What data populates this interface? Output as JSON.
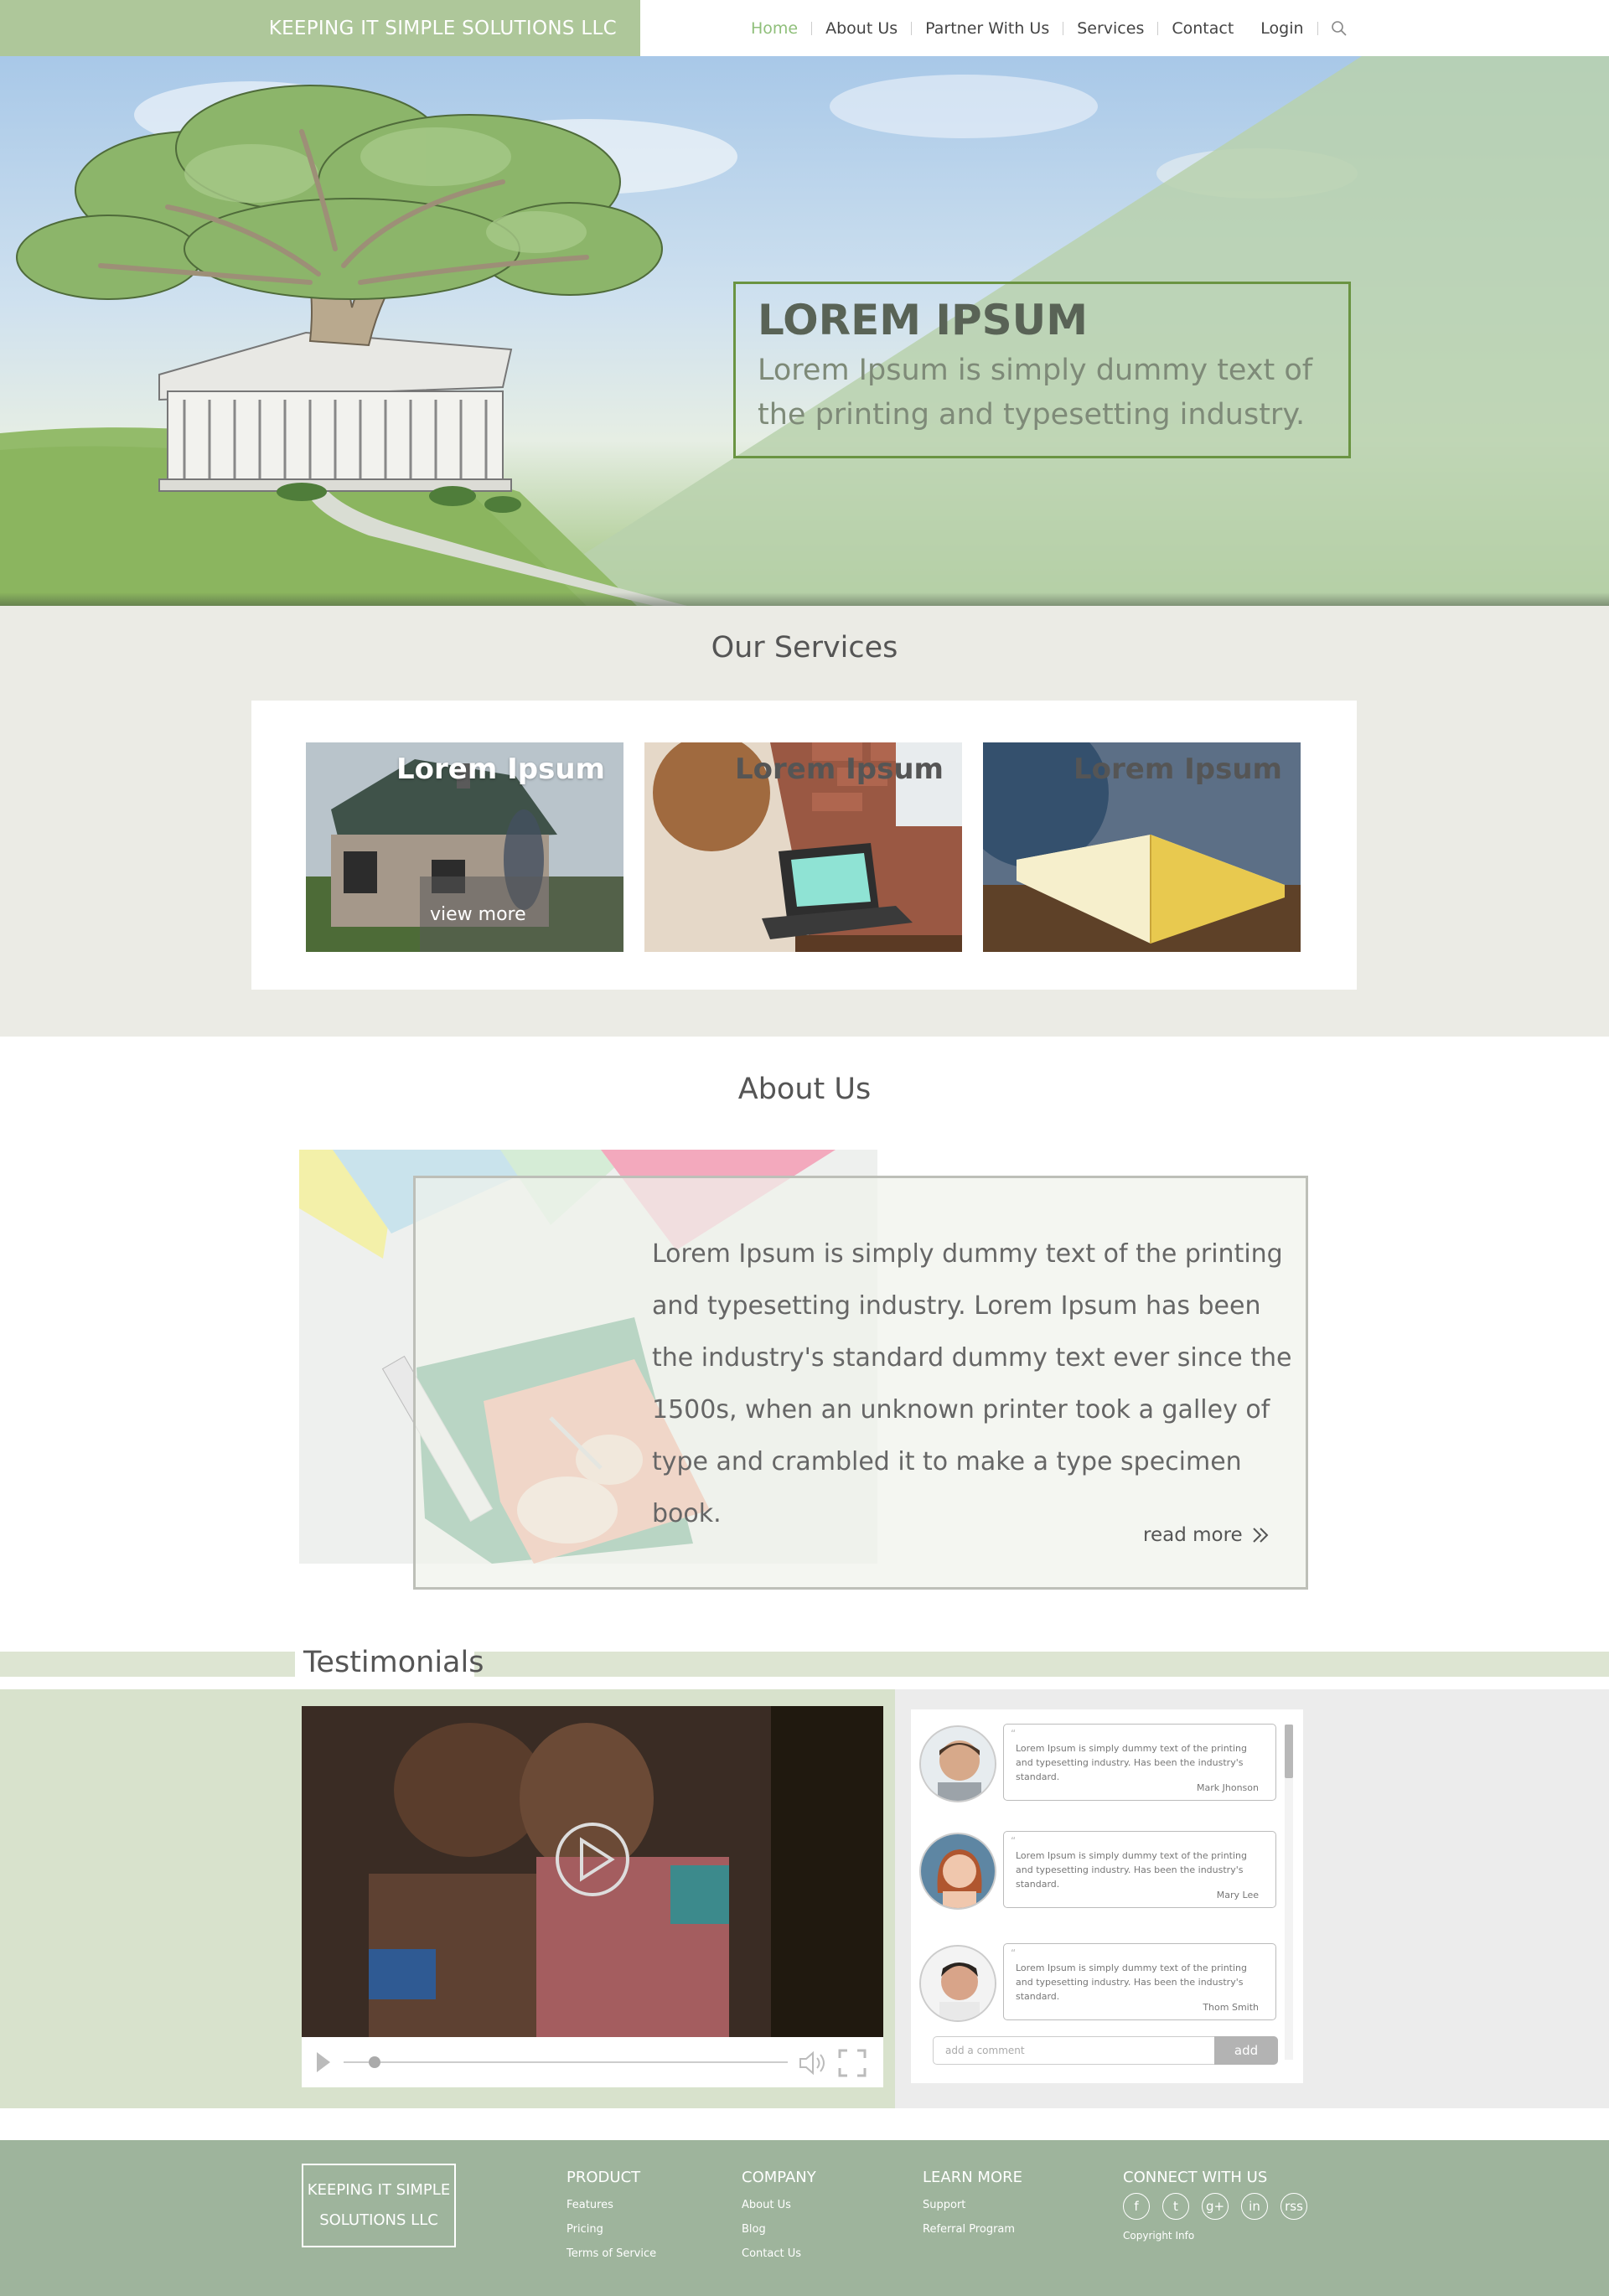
{
  "header": {
    "brand": "KEEPING IT SIMPLE SOLUTIONS LLC",
    "nav": [
      "Home",
      "About Us",
      "Partner With Us",
      "Services",
      "Contact",
      "Login"
    ],
    "search_icon": "search-icon"
  },
  "hero": {
    "title": "LOREM IPSUM",
    "subtitle": "Lorem Ipsum is simply dummy text of the printing and typesetting industry."
  },
  "services": {
    "title": "Our Services",
    "cards": [
      {
        "label": "Lorem Ipsum",
        "more": "view more"
      },
      {
        "label": "Lorem Ipsum"
      },
      {
        "label": "Lorem Ipsum"
      }
    ]
  },
  "about": {
    "title": "About Us",
    "text": "Lorem Ipsum is simply dummy text of the printing and typesetting industry. Lorem Ipsum has been the industry's standard dummy text ever since the 1500s, when an unknown printer took a galley of type and crambled it to make a type specimen book.",
    "read_more": "read more"
  },
  "testimonials": {
    "title": "Testimonials",
    "video": {
      "play_icon": "play-icon",
      "progress": 0.07
    },
    "comments": [
      {
        "quote": "“",
        "text": "Lorem Ipsum is simply dummy text of the printing and typesetting industry. Has been the industry's standard.",
        "name": "Mark Jhonson"
      },
      {
        "quote": "“",
        "text": "Lorem Ipsum is simply dummy text of the printing and typesetting industry. Has been the industry's standard.",
        "name": "Mary Lee"
      },
      {
        "quote": "“",
        "text": "Lorem Ipsum is simply dummy text of the printing and typesetting industry. Has been the industry's standard.",
        "name": "Thom Smith"
      }
    ],
    "comment_placeholder": "add a comment",
    "add_label": "add"
  },
  "footer": {
    "brand_line1": "KEEPING IT SIMPLE",
    "brand_line2": "SOLUTIONS LLC",
    "product": {
      "title": "PRODUCT",
      "links": [
        "Features",
        "Pricing",
        "Terms of Service"
      ]
    },
    "company": {
      "title": "COMPANY",
      "links": [
        "About Us",
        "Blog",
        "Contact Us"
      ]
    },
    "learn": {
      "title": "LEARN MORE",
      "links": [
        "Support",
        "Referral Program"
      ]
    },
    "connect": {
      "title": "CONNECT WITH US",
      "icons": [
        "f",
        "t",
        "g+",
        "in",
        "rss"
      ],
      "copyright": "Copyright Info"
    }
  },
  "colors": {
    "brand_green": "#aec79a",
    "footer_green": "#9eb49c",
    "nav_active": "#8fbf7a",
    "hero_border": "#6a9442"
  }
}
